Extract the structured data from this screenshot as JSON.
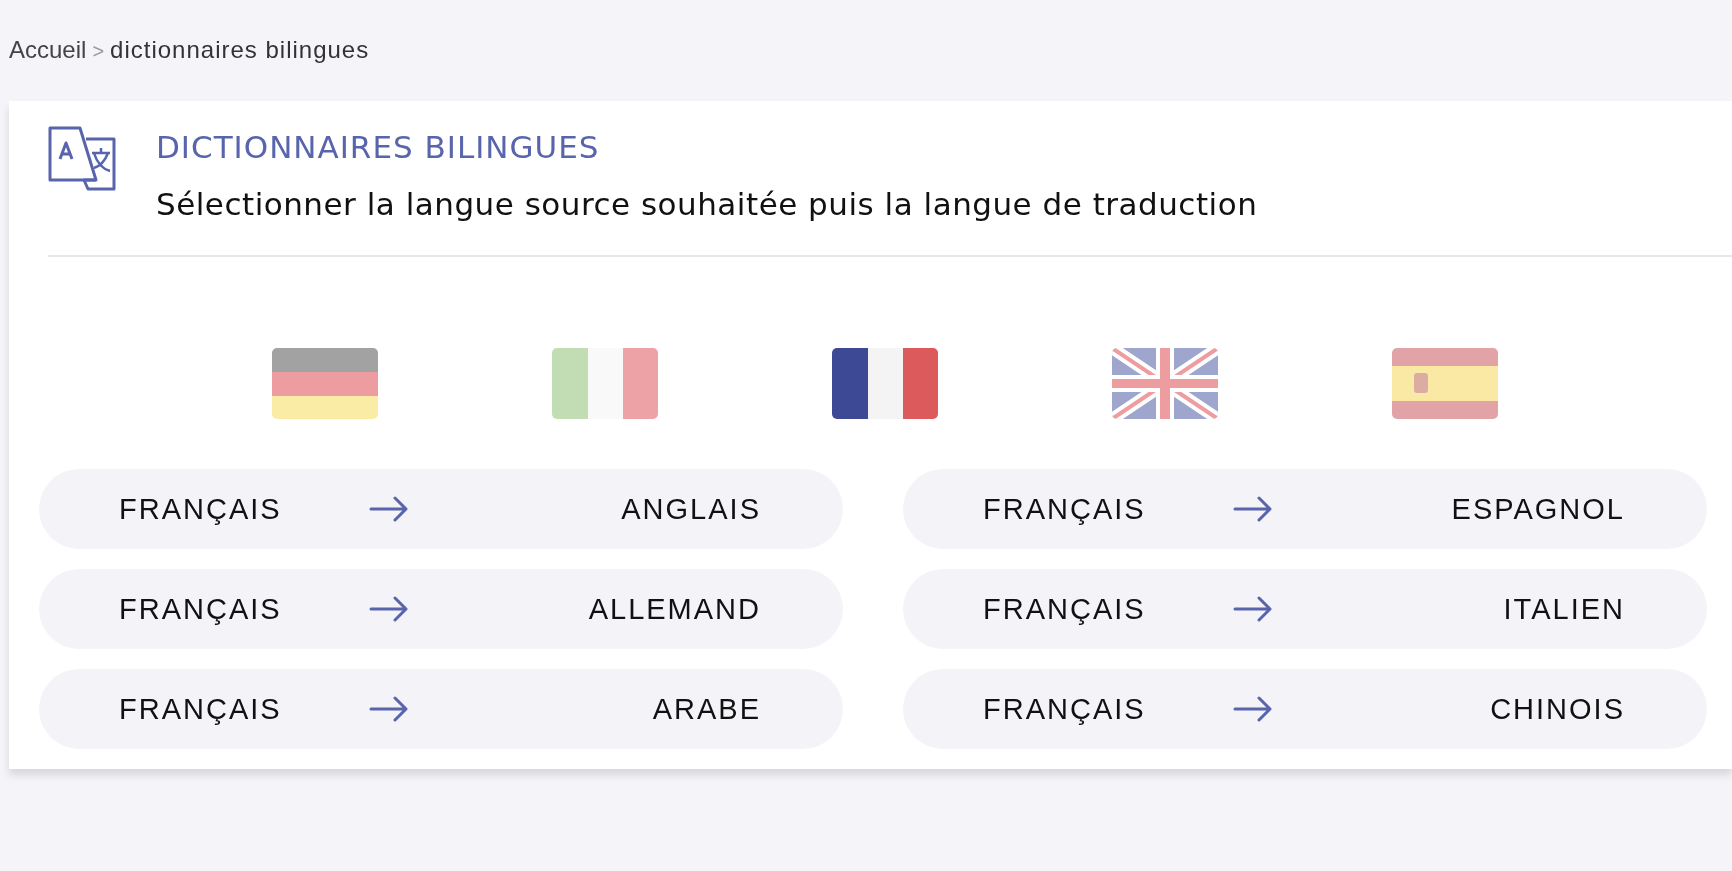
{
  "breadcrumb": {
    "home": "Accueil",
    "separator": ">",
    "current": "dictionnaires bilingues"
  },
  "header": {
    "title": "DICTIONNAIRES BILINGUES",
    "subtitle": "Sélectionner la langue source souhaitée puis la langue de traduction"
  },
  "flags": [
    {
      "selected": false
    },
    {
      "selected": false
    },
    {
      "selected": true
    },
    {
      "selected": false
    },
    {
      "selected": false
    }
  ],
  "pairs": [
    {
      "source": "FRANÇAIS",
      "target": "ANGLAIS"
    },
    {
      "source": "FRANÇAIS",
      "target": "ESPAGNOL"
    },
    {
      "source": "FRANÇAIS",
      "target": "ALLEMAND"
    },
    {
      "source": "FRANÇAIS",
      "target": "ITALIEN"
    },
    {
      "source": "FRANÇAIS",
      "target": "ARABE"
    },
    {
      "source": "FRANÇAIS",
      "target": "CHINOIS"
    }
  ]
}
